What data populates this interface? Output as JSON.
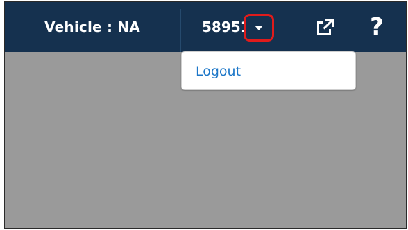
{
  "header": {
    "vehicle_label": "Vehicle : NA",
    "user_id": "58951",
    "dropdown_icon": "caret-down-icon",
    "external_link_icon": "external-link-icon",
    "help_label": "?"
  },
  "dropdown": {
    "items": [
      {
        "label": "Logout"
      }
    ]
  },
  "colors": {
    "header_bg": "#15314f",
    "page_bg": "#9a9a9a",
    "highlight": "#e01b1b",
    "link": "#1d77c8"
  }
}
